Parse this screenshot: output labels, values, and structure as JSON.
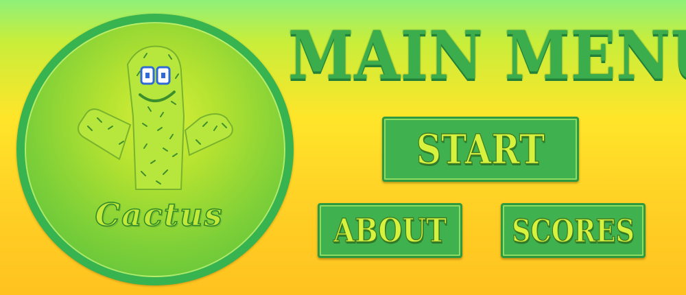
{
  "menu": {
    "title": "MAIN MENU",
    "buttons": {
      "start": "START",
      "about": "ABOUT",
      "scores": "SCORES"
    }
  },
  "logo": {
    "word": "Cactus",
    "mascot_icon": "cactus-mascot-icon"
  },
  "colors": {
    "background_top": "#8ff07a",
    "background_bottom": "#ffc21f",
    "button_fill": "#3fb24f",
    "button_text": "#d6f23e",
    "title_text": "#3cad4c",
    "logo_ring": "#37b34f"
  }
}
